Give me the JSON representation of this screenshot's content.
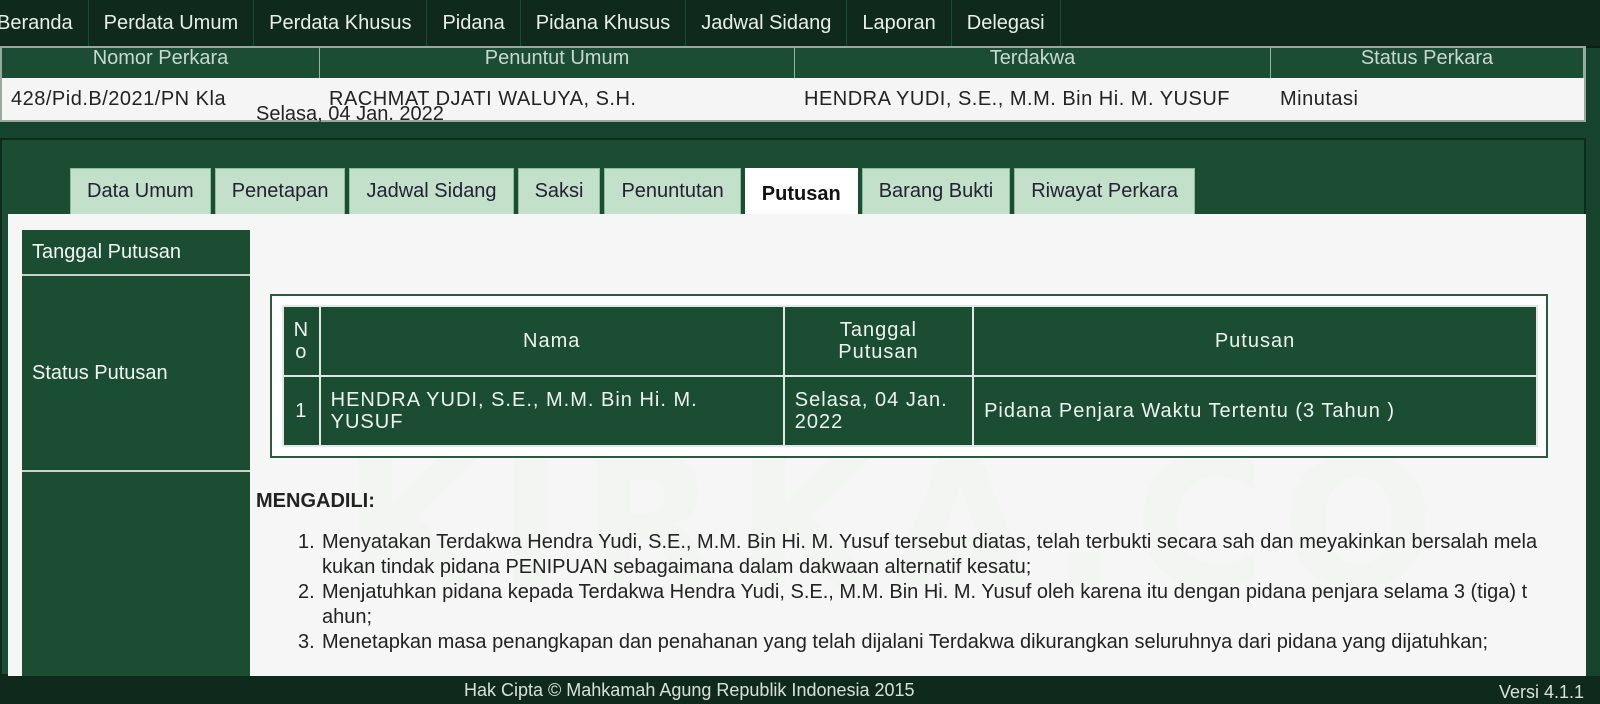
{
  "nav": {
    "items": [
      "Beranda",
      "Perdata Umum",
      "Perdata Khusus",
      "Pidana",
      "Pidana Khusus",
      "Jadwal Sidang",
      "Laporan",
      "Delegasi"
    ]
  },
  "case": {
    "headers": [
      "Nomor Perkara",
      "Penuntut Umum",
      "Terdakwa",
      "Status Perkara"
    ],
    "values": [
      "428/Pid.B/2021/PN Kla",
      "RACHMAT DJATI WALUYA, S.H.",
      "HENDRA YUDI, S.E., M.M. Bin Hi. M. YUSUF",
      "Minutasi"
    ]
  },
  "tabs": [
    "Data Umum",
    "Penetapan",
    "Jadwal Sidang",
    "Saksi",
    "Penuntutan",
    "Putusan",
    "Barang Bukti",
    "Riwayat Perkara"
  ],
  "active_tab": "Putusan",
  "labels": {
    "tanggal_putusan": "Tanggal Putusan",
    "status_putusan": "Status Putusan"
  },
  "tanggal_putusan_value": "Selasa, 04 Jan. 2022",
  "verdict_table": {
    "headers": [
      "No",
      "Nama",
      "Tanggal Putusan",
      "Putusan"
    ],
    "rows": [
      {
        "no": "1",
        "nama": "HENDRA YUDI, S.E., M.M. Bin Hi. M. YUSUF",
        "tanggal": "Selasa, 04 Jan. 2022",
        "putusan": "Pidana Penjara Waktu Tertentu (3 Tahun )"
      }
    ]
  },
  "amar": {
    "title": "MENGADILI:",
    "items": [
      {
        "num": "1.",
        "text": "Menyatakan Terdakwa Hendra Yudi, S.E., M.M. Bin Hi. M. Yusuf tersebut diatas, telah terbukti secara sah dan meyakinkan bersalah melakukan tindak pidana PENIPUAN sebagaimana dalam dakwaan alternatif kesatu;"
      },
      {
        "num": "2.",
        "text": "Menjatuhkan pidana kepada Terdakwa Hendra Yudi, S.E., M.M. Bin Hi. M. Yusuf oleh karena itu dengan pidana penjara selama 3 (tiga) tahun;"
      },
      {
        "num": "3.",
        "text": "Menetapkan masa penangkapan dan penahanan yang telah dijalani Terdakwa dikurangkan seluruhnya dari pidana yang dijatuhkan;"
      }
    ]
  },
  "footer": {
    "copyright": "Hak Cipta © Mahkamah Agung Republik Indonesia 2015",
    "version": "Versi 4.1.1"
  },
  "watermark": "KIRKA.CO",
  "colors": {
    "primary_green": "#1b4d33",
    "dark_green": "#0f2a1c",
    "tab_inactive": "#c3e0cb"
  }
}
